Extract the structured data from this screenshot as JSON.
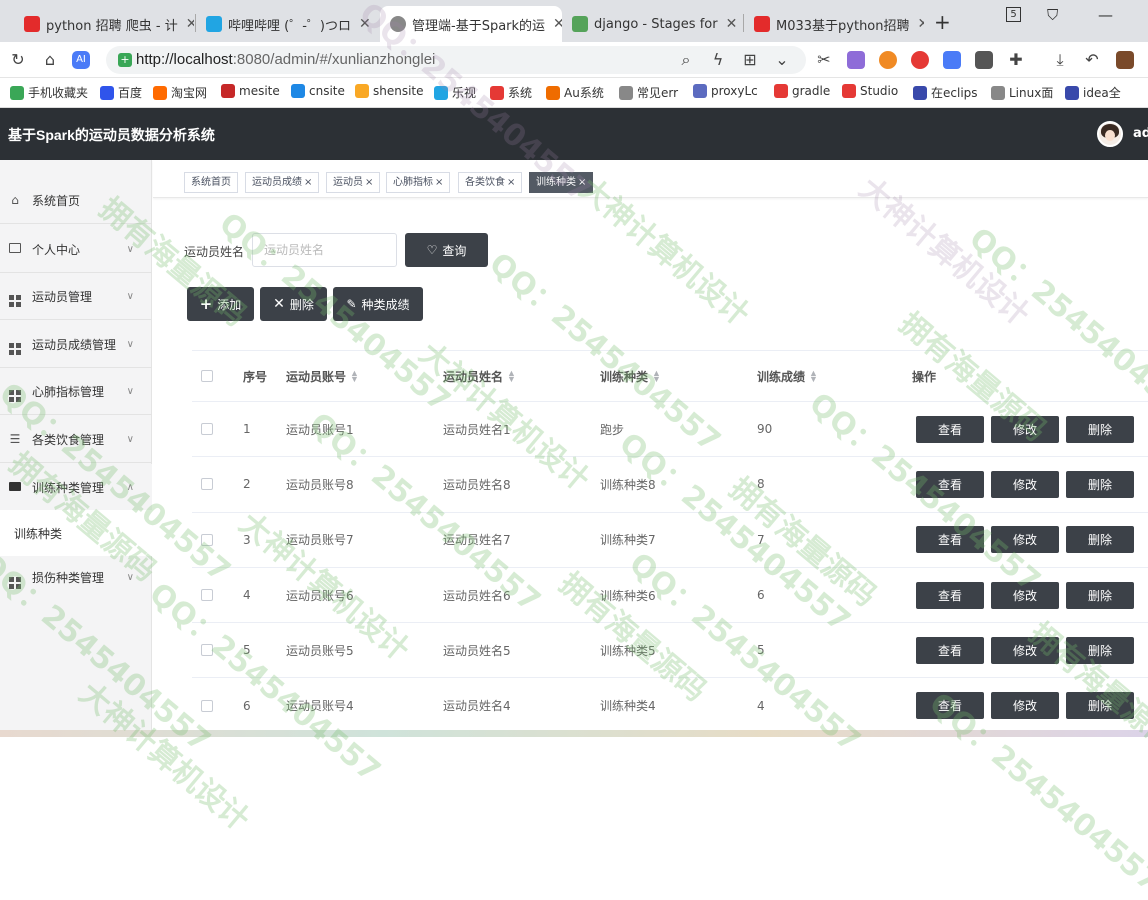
{
  "browser": {
    "tabs": [
      {
        "title": "python 招聘 爬虫 - 计",
        "icon_color": "#e32b2b"
      },
      {
        "title": "哔哩哔哩 (゜-゜)つロ",
        "icon_color": "#21a5e3"
      },
      {
        "title": "管理端-基于Spark的运",
        "icon_color": "#888888"
      },
      {
        "title": "django - Stages for",
        "icon_color": "#55a35a"
      },
      {
        "title": "M033基于python招聘",
        "icon_color": "#e32b2b"
      }
    ],
    "tab_number_badge": "5",
    "url_host": "http://localhost",
    "url_path": ":8080/admin/#/xunlianzhonglei",
    "bookmarks": [
      {
        "label": "手机收藏夹",
        "color": "#3aa757"
      },
      {
        "label": "百度",
        "color": "#2f54eb"
      },
      {
        "label": "淘宝网",
        "color": "#ff6a00"
      },
      {
        "label": "mesite",
        "color": "#c62828"
      },
      {
        "label": "cnsite",
        "color": "#1e88e5"
      },
      {
        "label": "shensite",
        "color": "#f9a825"
      },
      {
        "label": "乐视",
        "color": "#21a5e3"
      },
      {
        "label": "系统",
        "color": "#e53935"
      },
      {
        "label": "Au系统",
        "color": "#ef6c00"
      },
      {
        "label": "常见err",
        "color": "#888888"
      },
      {
        "label": "proxyLc",
        "color": "#5c6bc0"
      },
      {
        "label": "gradle",
        "color": "#e53935"
      },
      {
        "label": "Studio",
        "color": "#e53935"
      },
      {
        "label": "在eclips",
        "color": "#3949ab"
      },
      {
        "label": "Linux面",
        "color": "#888888"
      },
      {
        "label": "idea全",
        "color": "#3949ab"
      }
    ]
  },
  "header": {
    "title": "基于Spark的运动员数据分析系统",
    "user": "ad"
  },
  "sidebar": {
    "items": [
      {
        "label": "系统首页",
        "icon": "home-icon",
        "chevron": ""
      },
      {
        "label": "个人中心",
        "icon": "card-icon",
        "chevron": "∨"
      },
      {
        "label": "运动员管理",
        "icon": "grid-icon",
        "chevron": "∨"
      },
      {
        "label": "运动员成绩管理",
        "icon": "grid-icon",
        "chevron": "∨"
      },
      {
        "label": "心肺指标管理",
        "icon": "grid-icon",
        "chevron": "∨"
      },
      {
        "label": "各类饮食管理",
        "icon": "sliders-icon",
        "chevron": "∨"
      },
      {
        "label": "训练种类管理",
        "icon": "briefcase-icon",
        "chevron": "∧"
      }
    ],
    "submenu": "训练种类",
    "after_submenu": {
      "label": "损伤种类管理",
      "icon": "grid-icon",
      "chevron": "∨"
    }
  },
  "tags": [
    {
      "label": "系统首页",
      "closable": false
    },
    {
      "label": "运动员成绩",
      "closable": true
    },
    {
      "label": "运动员",
      "closable": true
    },
    {
      "label": "心肺指标",
      "closable": true
    },
    {
      "label": "各类饮食",
      "closable": true
    },
    {
      "label": "训练种类",
      "closable": true,
      "active": true
    }
  ],
  "search": {
    "label": "运动员姓名",
    "placeholder": "运动员姓名",
    "button": "查询"
  },
  "actions": {
    "add": "添加",
    "delete": "删除",
    "grade": "种类成绩"
  },
  "table": {
    "headers": [
      "序号",
      "运动员账号",
      "运动员姓名",
      "训练种类",
      "训练成绩",
      "操作"
    ],
    "rows": [
      {
        "no": "1",
        "account": "运动员账号1",
        "name": "运动员姓名1",
        "type": "跑步",
        "score": "90"
      },
      {
        "no": "2",
        "account": "运动员账号8",
        "name": "运动员姓名8",
        "type": "训练种类8",
        "score": "8"
      },
      {
        "no": "3",
        "account": "运动员账号7",
        "name": "运动员姓名7",
        "type": "训练种类7",
        "score": "7"
      },
      {
        "no": "4",
        "account": "运动员账号6",
        "name": "运动员姓名6",
        "type": "训练种类6",
        "score": "6"
      },
      {
        "no": "5",
        "account": "运动员账号5",
        "name": "运动员姓名5",
        "type": "训练种类5",
        "score": "5"
      },
      {
        "no": "6",
        "account": "运动员账号4",
        "name": "运动员姓名4",
        "type": "训练种类4",
        "score": "4"
      }
    ],
    "row_buttons": {
      "view": "查看",
      "edit": "修改",
      "delete": "删除"
    }
  },
  "watermark": {
    "texts": [
      "拥有海量源码",
      "QQ：2545404557",
      "大神计算机设计"
    ]
  }
}
